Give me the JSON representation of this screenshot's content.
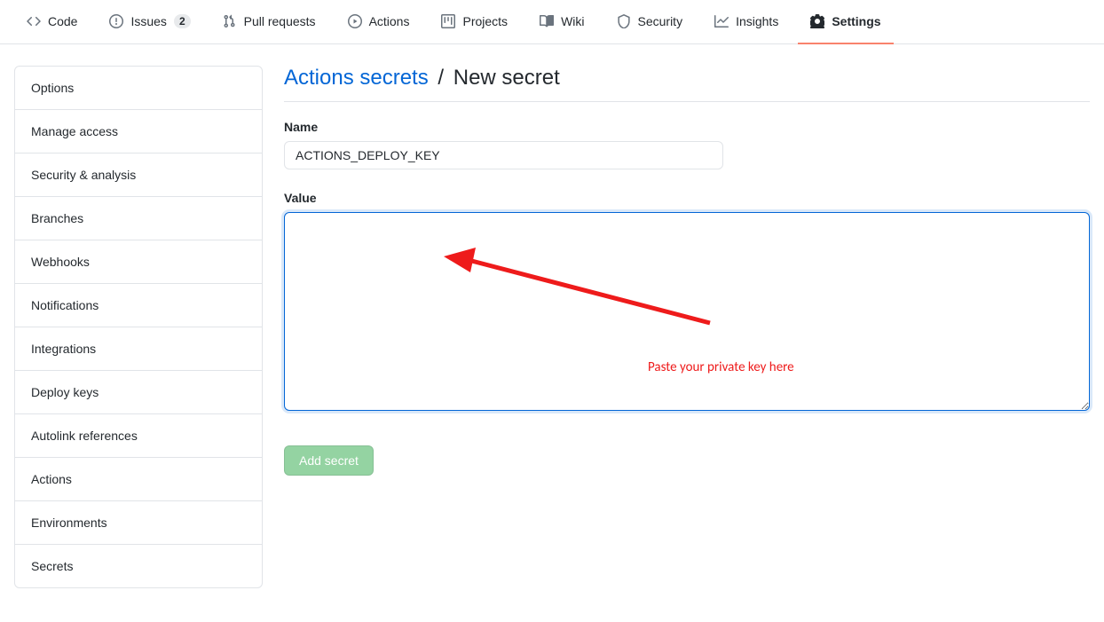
{
  "topnav": {
    "items": [
      {
        "label": "Code"
      },
      {
        "label": "Issues",
        "badge": "2"
      },
      {
        "label": "Pull requests"
      },
      {
        "label": "Actions"
      },
      {
        "label": "Projects"
      },
      {
        "label": "Wiki"
      },
      {
        "label": "Security"
      },
      {
        "label": "Insights"
      },
      {
        "label": "Settings"
      }
    ]
  },
  "sidebar": {
    "items": [
      {
        "label": "Options"
      },
      {
        "label": "Manage access"
      },
      {
        "label": "Security & analysis"
      },
      {
        "label": "Branches"
      },
      {
        "label": "Webhooks"
      },
      {
        "label": "Notifications"
      },
      {
        "label": "Integrations"
      },
      {
        "label": "Deploy keys"
      },
      {
        "label": "Autolink references"
      },
      {
        "label": "Actions"
      },
      {
        "label": "Environments"
      },
      {
        "label": "Secrets"
      }
    ]
  },
  "page": {
    "crumb_link": "Actions secrets",
    "crumb_sep": "/",
    "crumb_current": "New secret"
  },
  "form": {
    "name_label": "Name",
    "name_value": "ACTIONS_DEPLOY_KEY",
    "value_label": "Value",
    "value_text": "",
    "submit_label": "Add secret"
  },
  "annotation": {
    "text": "Paste your private key here"
  }
}
